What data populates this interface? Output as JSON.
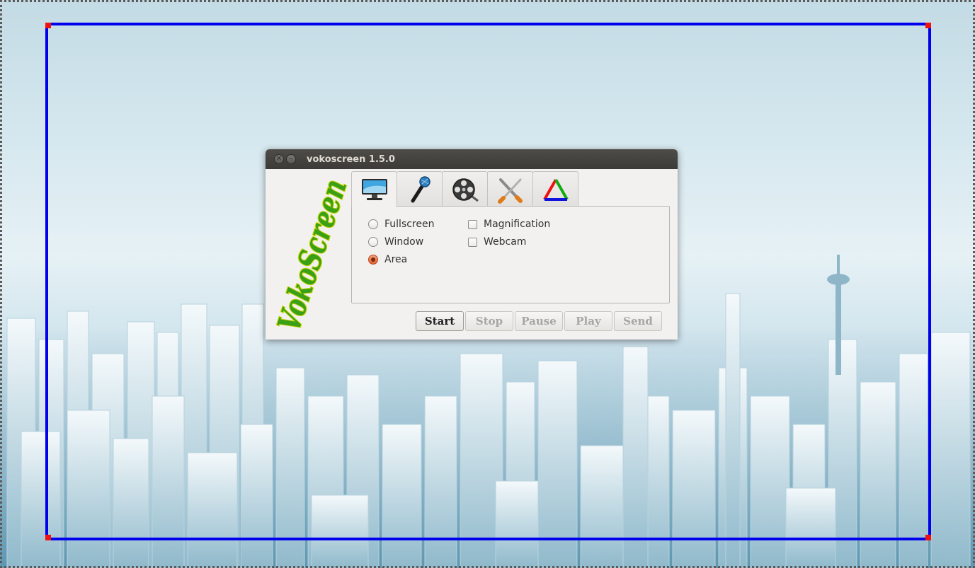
{
  "window": {
    "title": "vokoscreen 1.5.0",
    "logo_text": "VokoScreen"
  },
  "tabs": [
    {
      "icon": "monitor-icon",
      "active": true
    },
    {
      "icon": "microphone-icon",
      "active": false
    },
    {
      "icon": "film-reel-icon",
      "active": false
    },
    {
      "icon": "tools-icon",
      "active": false
    },
    {
      "icon": "rgb-triangle-icon",
      "active": false
    }
  ],
  "capture": {
    "radios": [
      {
        "label": "Fullscreen",
        "checked": false
      },
      {
        "label": "Window",
        "checked": false
      },
      {
        "label": "Area",
        "checked": true
      }
    ],
    "checkboxes": [
      {
        "label": "Magnification",
        "checked": false
      },
      {
        "label": "Webcam",
        "checked": false
      }
    ]
  },
  "buttons": {
    "start": "Start",
    "stop": "Stop",
    "pause": "Pause",
    "play": "Play",
    "send": "Send"
  },
  "colors": {
    "area_frame": "#0000ee",
    "area_handles": "#ee1111",
    "logo_green": "#3aa015",
    "logo_outline": "#c8d400"
  }
}
